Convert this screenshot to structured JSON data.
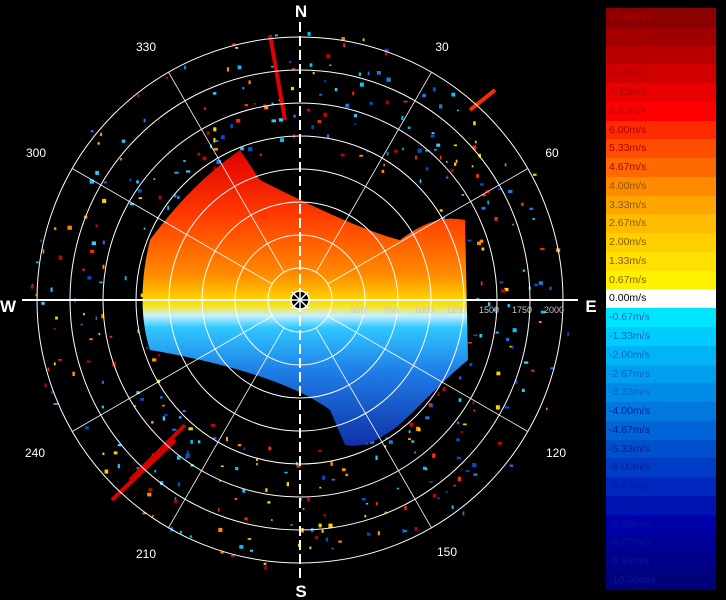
{
  "radar": {
    "compass": {
      "north": "N",
      "east": "E",
      "south": "S",
      "west": "W"
    },
    "bearings": [
      "30",
      "60",
      "120",
      "150",
      "210",
      "240",
      "300",
      "330"
    ],
    "range_labels": [
      "500",
      "750",
      "1000",
      "1250",
      "1500",
      "1750",
      "2000"
    ]
  },
  "colorbar": {
    "entries": [
      {
        "label": "10.00m/s",
        "value": 10.0,
        "color": "#8b0000"
      },
      {
        "label": "9.33m/s",
        "value": 9.33,
        "color": "#a00000"
      },
      {
        "label": "8.67m/s",
        "value": 8.67,
        "color": "#b80000"
      },
      {
        "label": "8.00m/s",
        "value": 8.0,
        "color": "#d00000"
      },
      {
        "label": "7.33m/s",
        "value": 7.33,
        "color": "#e80000"
      },
      {
        "label": "6.67m/s",
        "value": 6.67,
        "color": "#ff0000"
      },
      {
        "label": "6.00m/s",
        "value": 6.0,
        "color": "#ff2a00"
      },
      {
        "label": "5.33m/s",
        "value": 5.33,
        "color": "#ff4d00"
      },
      {
        "label": "4.67m/s",
        "value": 4.67,
        "color": "#ff6a00"
      },
      {
        "label": "4.00m/s",
        "value": 4.0,
        "color": "#ff8a00"
      },
      {
        "label": "3.33m/s",
        "value": 3.33,
        "color": "#ffa500"
      },
      {
        "label": "2.67m/s",
        "value": 2.67,
        "color": "#ffbb00"
      },
      {
        "label": "2.00m/s",
        "value": 2.0,
        "color": "#ffd000"
      },
      {
        "label": "1.33m/s",
        "value": 1.33,
        "color": "#ffe000"
      },
      {
        "label": "0.67m/s",
        "value": 0.67,
        "color": "#fff000"
      },
      {
        "label": "0.00m/s",
        "value": 0.0,
        "color": "#ffffff"
      },
      {
        "label": "-0.67m/s",
        "value": -0.67,
        "color": "#00e5ff"
      },
      {
        "label": "-1.33m/s",
        "value": -1.33,
        "color": "#00ccff"
      },
      {
        "label": "-2.00m/s",
        "value": -2.0,
        "color": "#00b4f5"
      },
      {
        "label": "-2.67m/s",
        "value": -2.67,
        "color": "#00a0ee"
      },
      {
        "label": "-3.33m/s",
        "value": -3.33,
        "color": "#008ce6"
      },
      {
        "label": "-4.00m/s",
        "value": -4.0,
        "color": "#0078de"
      },
      {
        "label": "-4.67m/s",
        "value": -4.67,
        "color": "#0064d6"
      },
      {
        "label": "-5.33m/s",
        "value": -5.33,
        "color": "#0050ce"
      },
      {
        "label": "-6.00m/s",
        "value": -6.0,
        "color": "#003cc6"
      },
      {
        "label": "-6.67m/s",
        "value": -6.67,
        "color": "#0028be"
      },
      {
        "label": "-7.33m/s",
        "value": -7.33,
        "color": "#0014b4"
      },
      {
        "label": "-8.00m/s",
        "value": -8.0,
        "color": "#0000aa"
      },
      {
        "label": "-8.67m/s",
        "value": -8.67,
        "color": "#000098"
      },
      {
        "label": "-9.33m/s",
        "value": -9.33,
        "color": "#000088"
      },
      {
        "label": "-10.00m/s",
        "value": -10.0,
        "color": "#00007a"
      }
    ]
  }
}
